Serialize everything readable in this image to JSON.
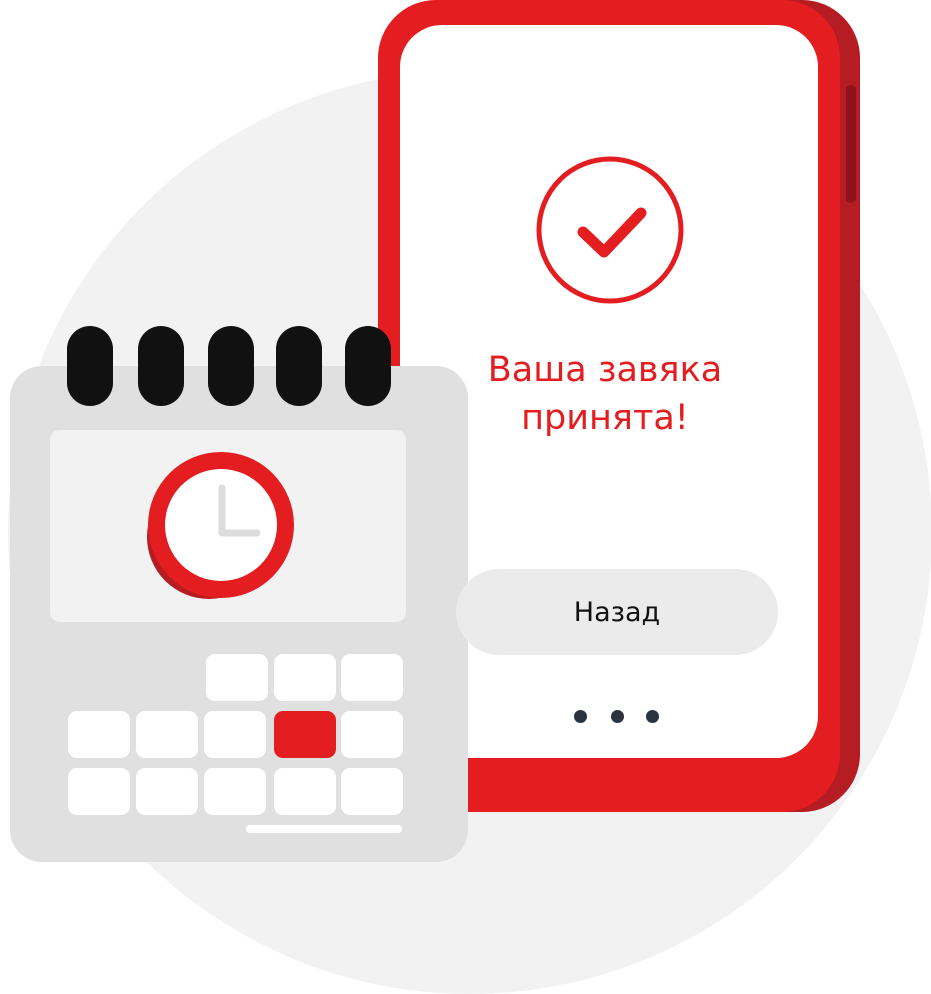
{
  "message": {
    "line1": "Ваша завяка",
    "line2": "принята!"
  },
  "back_button": {
    "label": "Назад"
  },
  "icons": {
    "success": "check-circle-icon",
    "clock": "clock-icon",
    "more": "ellipsis-icon"
  },
  "colors": {
    "accent": "#e41e20",
    "accent_dark": "#b51d23",
    "background_circle": "#f2f2f2",
    "calendar_gray": "#e0e0e0",
    "button_gray": "#ebebeb",
    "ring_black": "#111111",
    "dots": "#2a3340"
  }
}
